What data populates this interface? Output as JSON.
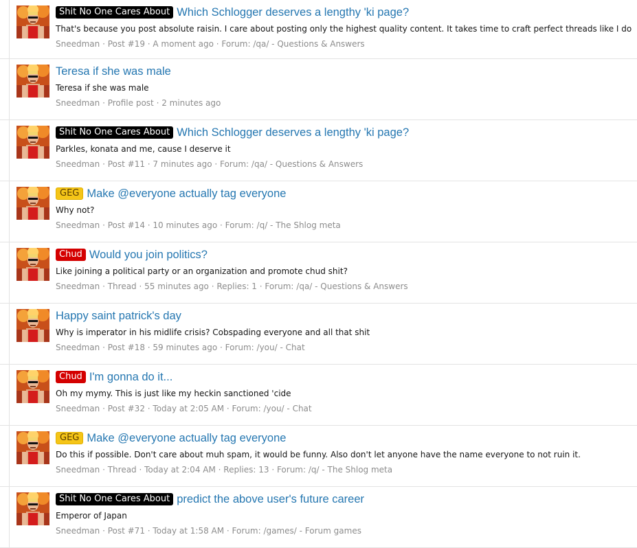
{
  "results": [
    {
      "prefix": "Shit No One Cares About",
      "prefix_style": "black",
      "title": "Which Schlogger deserves a lengthy 'ki page?",
      "snippet": "That's because you post absolute raisin. I care about posting only the highest quality content. It takes time to craft perfect threads like I do",
      "author": "Sneedman",
      "meta": " · Post #19 · A moment ago · Forum: ",
      "forum": "/qa/ - Questions & Answers"
    },
    {
      "prefix": "",
      "prefix_style": "",
      "title": "Teresa if she was male",
      "snippet": "Teresa if she was male",
      "author": "Sneedman",
      "meta": " · Profile post · 2 minutes ago",
      "forum": ""
    },
    {
      "prefix": "Shit No One Cares About",
      "prefix_style": "black",
      "title": "Which Schlogger deserves a lengthy 'ki page?",
      "snippet": "Parkles, konata and me, cause I deserve it",
      "author": "Sneedman",
      "meta": " · Post #11 · 7 minutes ago · Forum: ",
      "forum": "/qa/ - Questions & Answers"
    },
    {
      "prefix": "GEG",
      "prefix_style": "yellow",
      "title": "Make @everyone actually tag everyone",
      "snippet": "Why not?",
      "author": "Sneedman",
      "meta": " · Post #14 · 10 minutes ago · Forum: ",
      "forum": "/q/ - The Shlog meta"
    },
    {
      "prefix": "Chud",
      "prefix_style": "red",
      "title": "Would you join politics?",
      "snippet": "Like joining a political party or an organization and promote chud shit?",
      "author": "Sneedman",
      "meta": " · Thread · 55 minutes ago · Replies: 1 · Forum: ",
      "forum": "/qa/ - Questions & Answers"
    },
    {
      "prefix": "",
      "prefix_style": "",
      "title": "Happy saint patrick's day",
      "snippet": "Why is imperator in his midlife crisis? Cobspading everyone and all that shit",
      "author": "Sneedman",
      "meta": " · Post #18 · 59 minutes ago · Forum: ",
      "forum": "/you/ - Chat"
    },
    {
      "prefix": "Chud",
      "prefix_style": "red",
      "title": "I'm gonna do it...",
      "snippet": "Oh my mymy. This is just like my heckin sanctioned 'cide",
      "author": "Sneedman",
      "meta": " · Post #32 · Today at 2:05 AM · Forum: ",
      "forum": "/you/ - Chat"
    },
    {
      "prefix": "GEG",
      "prefix_style": "yellow",
      "title": "Make @everyone actually tag everyone",
      "snippet": "Do this if possible. Don't care about muh spam, it would be funny. Also don't let anyone have the name everyone to not ruin it.",
      "author": "Sneedman",
      "meta": " · Thread · Today at 2:04 AM · Replies: 13 · Forum: ",
      "forum": "/q/ - The Shlog meta"
    },
    {
      "prefix": "Shit No One Cares About",
      "prefix_style": "black",
      "title": "predict the above user's future career",
      "snippet": "Emperor of Japan",
      "author": "Sneedman",
      "meta": " · Post #71 · Today at 1:58 AM · Forum: ",
      "forum": "/games/ - Forum games"
    }
  ]
}
